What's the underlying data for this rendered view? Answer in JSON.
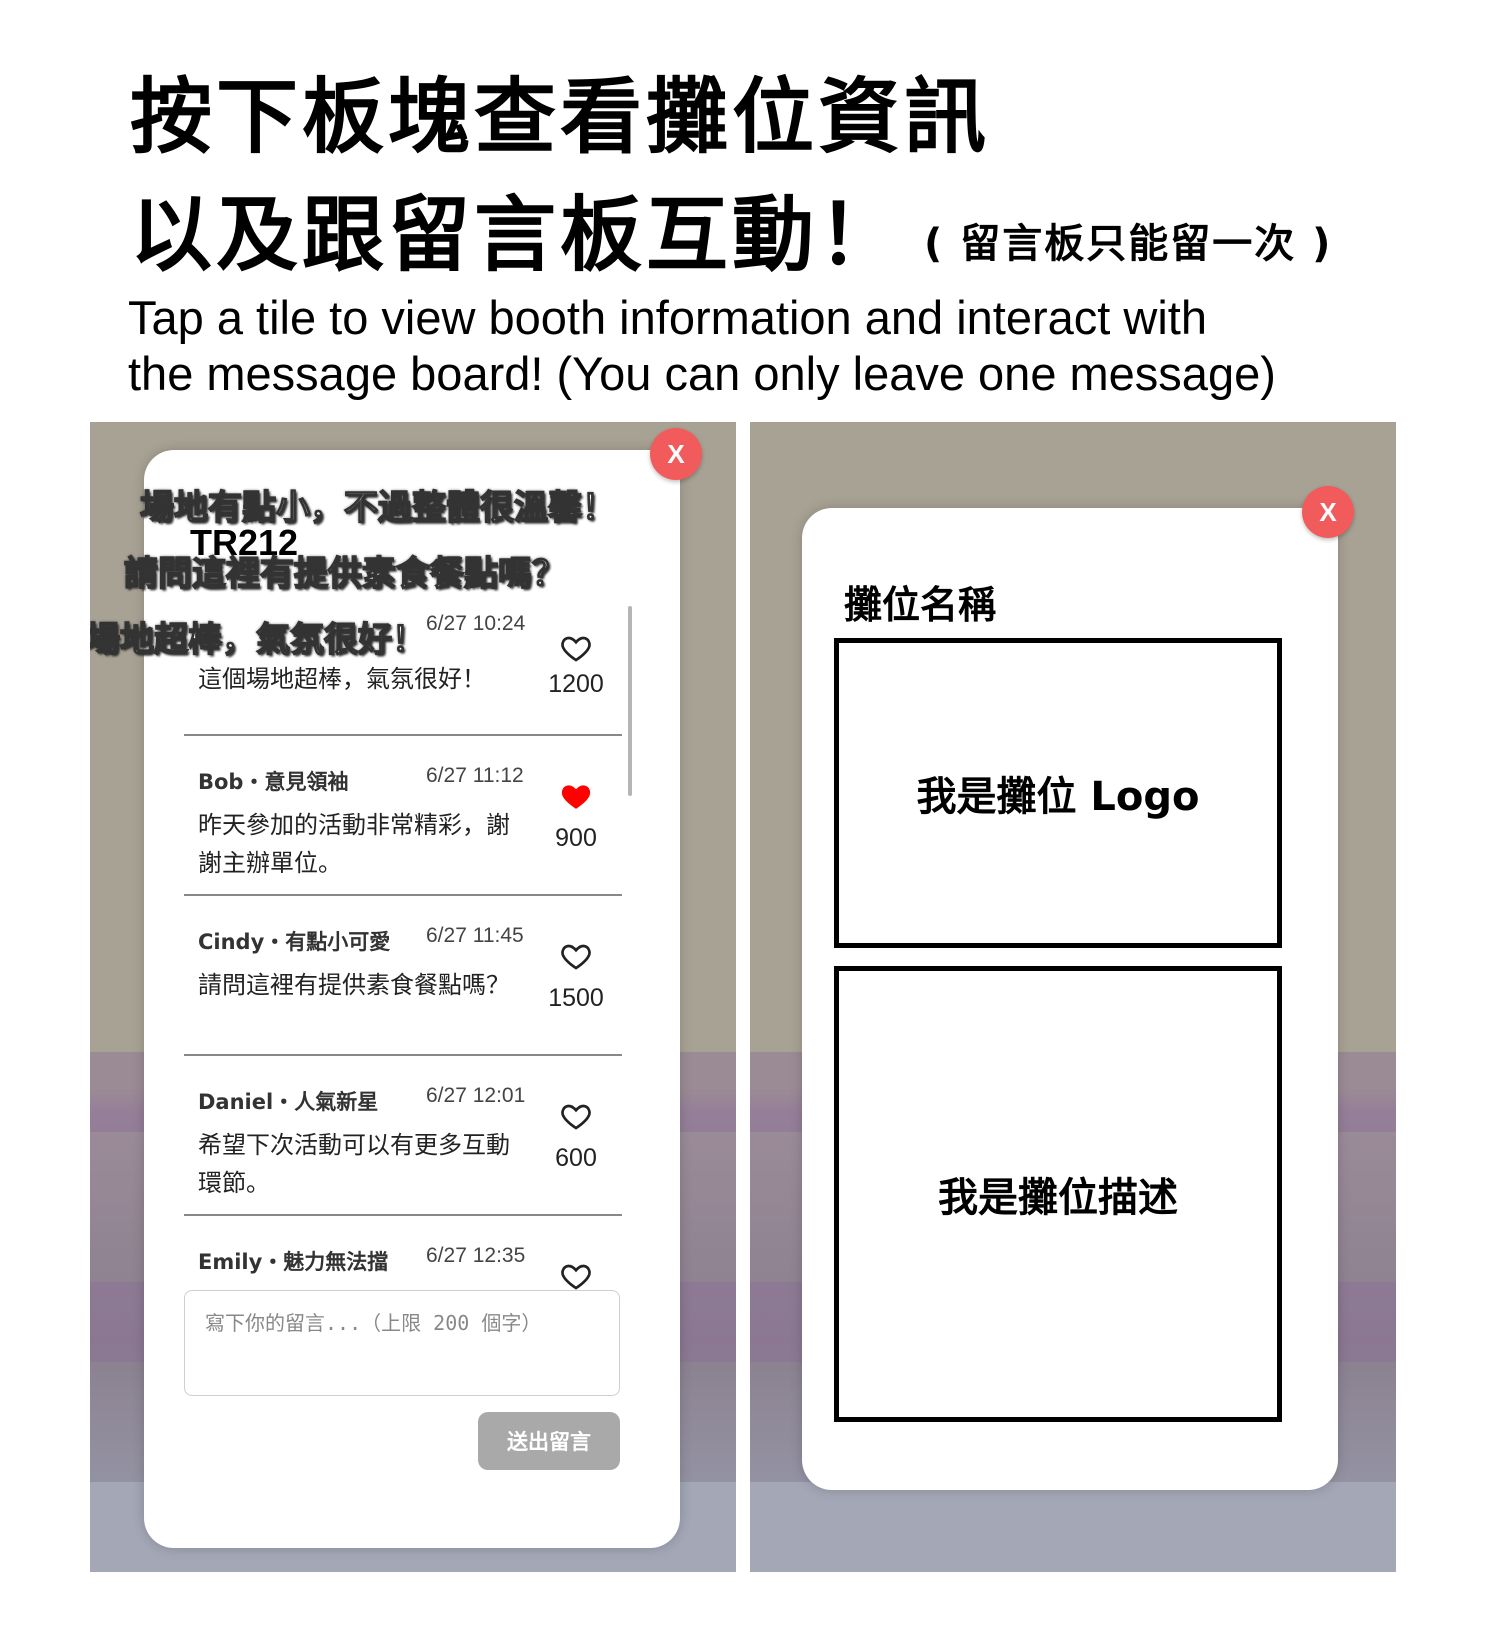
{
  "header": {
    "line1": "按下板塊查看攤位資訊",
    "line2": "以及跟留言板互動！",
    "line2_note": "( 留言板只能留一次 )",
    "english_line1": "Tap a tile to view booth information and interact with",
    "english_line2": "the message board!  (You can only leave one message)"
  },
  "left_panel": {
    "close_label": "X",
    "booth_code": "TR212",
    "floating_comments": [
      "場地有點小，不過整體很溫馨！",
      "請問這裡有提供素食餐點嗎？",
      "場地超棒，氣氛很好！"
    ],
    "comments": [
      {
        "user": "",
        "time": "6/27 10:24",
        "text": "這個場地超棒，氣氛很好！",
        "likes": "1200",
        "liked": false
      },
      {
        "user": "Bob・意見領袖",
        "time": "6/27 11:12",
        "text": "昨天參加的活動非常精彩，謝謝主辦單位。",
        "likes": "900",
        "liked": true
      },
      {
        "user": "Cindy・有點小可愛",
        "time": "6/27 11:45",
        "text": "請問這裡有提供素食餐點嗎？",
        "likes": "1500",
        "liked": false
      },
      {
        "user": "Daniel・人氣新星",
        "time": "6/27 12:01",
        "text": "希望下次活動可以有更多互動環節。",
        "likes": "600",
        "liked": false
      },
      {
        "user": "Emily・魅力無法擋",
        "time": "6/27 12:35",
        "text": "",
        "likes": "",
        "liked": false
      }
    ],
    "input_placeholder": "寫下你的留言...（上限 200 個字）",
    "submit_label": "送出留言",
    "colors": {
      "close": "#f25b5b",
      "heart_liked": "#ff0000",
      "submit": "#a9a9a9"
    }
  },
  "right_panel": {
    "close_label": "X",
    "booth_name": "攤位名稱",
    "logo_placeholder": "我是攤位 Logo",
    "description_placeholder": "我是攤位描述"
  }
}
